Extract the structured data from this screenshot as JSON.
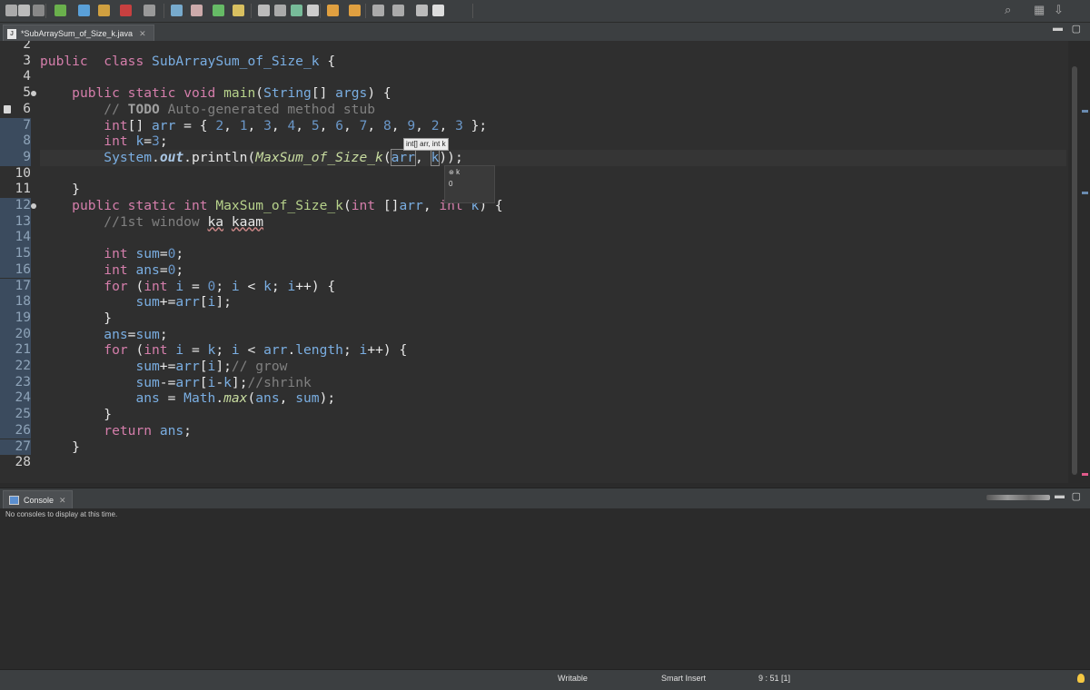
{
  "tab": {
    "title": "*SubArraySum_of_Size_k.java"
  },
  "editor": {
    "lines": [
      {
        "n": "2",
        "segs": []
      },
      {
        "n": "3",
        "segs": [
          [
            "kw",
            "public"
          ],
          [
            "",
            "  "
          ],
          [
            "kw",
            "class"
          ],
          [
            "",
            " "
          ],
          [
            "cls",
            "SubArraySum_of_Size_k"
          ],
          [
            "",
            " {"
          ]
        ]
      },
      {
        "n": "4",
        "segs": []
      },
      {
        "n": "5",
        "fold": true,
        "segs": [
          [
            "",
            "    "
          ],
          [
            "kw",
            "public"
          ],
          [
            "",
            " "
          ],
          [
            "kw",
            "static"
          ],
          [
            "",
            " "
          ],
          [
            "kw",
            "void"
          ],
          [
            "",
            " "
          ],
          [
            "mth",
            "main"
          ],
          [
            "",
            "("
          ],
          [
            "typ",
            "String"
          ],
          [
            "",
            "[] "
          ],
          [
            "typ",
            "args"
          ],
          [
            "",
            ") {"
          ]
        ]
      },
      {
        "n": "6",
        "marker": true,
        "segs": [
          [
            "cm",
            "        // "
          ],
          [
            "tag",
            "TODO"
          ],
          [
            "cm",
            " Auto-generated method stub"
          ]
        ]
      },
      {
        "n": "7",
        "segs": [
          [
            "",
            "        "
          ],
          [
            "kw",
            "int"
          ],
          [
            "",
            "[] "
          ],
          [
            "typ",
            "arr"
          ],
          [
            "",
            " = { "
          ],
          [
            "num",
            "2"
          ],
          [
            "",
            ", "
          ],
          [
            "num",
            "1"
          ],
          [
            "",
            ", "
          ],
          [
            "num",
            "3"
          ],
          [
            "",
            ", "
          ],
          [
            "num",
            "4"
          ],
          [
            "",
            ", "
          ],
          [
            "num",
            "5"
          ],
          [
            "",
            ", "
          ],
          [
            "num",
            "6"
          ],
          [
            "",
            ", "
          ],
          [
            "num",
            "7"
          ],
          [
            "",
            ", "
          ],
          [
            "num",
            "8"
          ],
          [
            "",
            ", "
          ],
          [
            "num",
            "9"
          ],
          [
            "",
            ", "
          ],
          [
            "num",
            "2"
          ],
          [
            "",
            ", "
          ],
          [
            "num",
            "3"
          ],
          [
            "",
            " };"
          ]
        ]
      },
      {
        "n": "8",
        "segs": [
          [
            "",
            "        "
          ],
          [
            "kw",
            "int"
          ],
          [
            "",
            " "
          ],
          [
            "typ",
            "k"
          ],
          [
            "",
            "="
          ],
          [
            "num",
            "3"
          ],
          [
            "",
            ";"
          ]
        ]
      },
      {
        "n": "9",
        "current": true,
        "segs": [
          [
            "",
            "        "
          ],
          [
            "cls",
            "System"
          ],
          [
            "",
            "."
          ],
          [
            "fld",
            "out"
          ],
          [
            "",
            ".println("
          ],
          [
            "itm",
            "MaxSum_of_Size_k"
          ],
          [
            "",
            "("
          ],
          [
            "box",
            "arr"
          ],
          [
            "",
            ", "
          ],
          [
            "box",
            "k"
          ],
          [
            "",
            "));"
          ]
        ]
      },
      {
        "n": "10",
        "segs": []
      },
      {
        "n": "11",
        "segs": [
          [
            "",
            "    }"
          ]
        ]
      },
      {
        "n": "12",
        "fold": true,
        "segs": [
          [
            "",
            "    "
          ],
          [
            "kw",
            "public"
          ],
          [
            "",
            " "
          ],
          [
            "kw",
            "static"
          ],
          [
            "",
            " "
          ],
          [
            "kw",
            "int"
          ],
          [
            "",
            " "
          ],
          [
            "mth",
            "MaxSum_of_Size_k"
          ],
          [
            "",
            "("
          ],
          [
            "kw",
            "int"
          ],
          [
            "",
            " []"
          ],
          [
            "typ",
            "arr"
          ],
          [
            "",
            ", "
          ],
          [
            "kw",
            "int"
          ],
          [
            "",
            " "
          ],
          [
            "typ",
            "k"
          ],
          [
            "",
            ") {"
          ]
        ]
      },
      {
        "n": "13",
        "segs": [
          [
            "cm",
            "        //1st window "
          ],
          [
            "sq",
            "ka"
          ],
          [
            "cm",
            " "
          ],
          [
            "sq",
            "kaam"
          ]
        ]
      },
      {
        "n": "14",
        "segs": []
      },
      {
        "n": "15",
        "segs": [
          [
            "",
            "        "
          ],
          [
            "kw",
            "int"
          ],
          [
            "",
            " "
          ],
          [
            "typ",
            "sum"
          ],
          [
            "",
            "="
          ],
          [
            "num",
            "0"
          ],
          [
            "",
            ";"
          ]
        ]
      },
      {
        "n": "16",
        "segs": [
          [
            "",
            "        "
          ],
          [
            "kw",
            "int"
          ],
          [
            "",
            " "
          ],
          [
            "typ",
            "ans"
          ],
          [
            "",
            "="
          ],
          [
            "num",
            "0"
          ],
          [
            "",
            ";"
          ]
        ]
      },
      {
        "n": "17",
        "segs": [
          [
            "",
            "        "
          ],
          [
            "kw",
            "for"
          ],
          [
            "",
            " ("
          ],
          [
            "kw",
            "int"
          ],
          [
            "",
            " "
          ],
          [
            "typ",
            "i"
          ],
          [
            "",
            " = "
          ],
          [
            "num",
            "0"
          ],
          [
            "",
            "; "
          ],
          [
            "typ",
            "i"
          ],
          [
            "",
            " < "
          ],
          [
            "typ",
            "k"
          ],
          [
            "",
            "; "
          ],
          [
            "typ",
            "i"
          ],
          [
            "",
            "++) {"
          ]
        ]
      },
      {
        "n": "18",
        "segs": [
          [
            "",
            "            "
          ],
          [
            "typ",
            "sum"
          ],
          [
            "",
            "+="
          ],
          [
            "typ",
            "arr"
          ],
          [
            "",
            "["
          ],
          [
            "typ",
            "i"
          ],
          [
            "",
            "];"
          ]
        ]
      },
      {
        "n": "19",
        "segs": [
          [
            "",
            "        }"
          ]
        ]
      },
      {
        "n": "20",
        "segs": [
          [
            "",
            "        "
          ],
          [
            "typ",
            "ans"
          ],
          [
            "",
            "="
          ],
          [
            "typ",
            "sum"
          ],
          [
            "",
            ";"
          ]
        ]
      },
      {
        "n": "21",
        "segs": [
          [
            "",
            "        "
          ],
          [
            "kw",
            "for"
          ],
          [
            "",
            " ("
          ],
          [
            "kw",
            "int"
          ],
          [
            "",
            " "
          ],
          [
            "typ",
            "i"
          ],
          [
            "",
            " = "
          ],
          [
            "typ",
            "k"
          ],
          [
            "",
            "; "
          ],
          [
            "typ",
            "i"
          ],
          [
            "",
            " < "
          ],
          [
            "typ",
            "arr"
          ],
          [
            "",
            "."
          ],
          [
            "typ",
            "length"
          ],
          [
            "",
            "; "
          ],
          [
            "typ",
            "i"
          ],
          [
            "",
            "++) {"
          ]
        ]
      },
      {
        "n": "22",
        "segs": [
          [
            "",
            "            "
          ],
          [
            "typ",
            "sum"
          ],
          [
            "",
            "+="
          ],
          [
            "typ",
            "arr"
          ],
          [
            "",
            "["
          ],
          [
            "typ",
            "i"
          ],
          [
            "",
            "];"
          ],
          [
            "cm",
            "// grow"
          ]
        ]
      },
      {
        "n": "23",
        "segs": [
          [
            "",
            "            "
          ],
          [
            "typ",
            "sum"
          ],
          [
            "",
            "-="
          ],
          [
            "typ",
            "arr"
          ],
          [
            "",
            "["
          ],
          [
            "typ",
            "i"
          ],
          [
            "",
            "-"
          ],
          [
            "typ",
            "k"
          ],
          [
            "",
            "];"
          ],
          [
            "cm",
            "//shrink"
          ]
        ]
      },
      {
        "n": "24",
        "segs": [
          [
            "",
            "            "
          ],
          [
            "typ",
            "ans"
          ],
          [
            "",
            " = "
          ],
          [
            "cls",
            "Math"
          ],
          [
            "",
            "."
          ],
          [
            "itm",
            "max"
          ],
          [
            "",
            "("
          ],
          [
            "typ",
            "ans"
          ],
          [
            "",
            ", "
          ],
          [
            "typ",
            "sum"
          ],
          [
            "",
            ");"
          ]
        ]
      },
      {
        "n": "25",
        "segs": [
          [
            "",
            "        }"
          ]
        ]
      },
      {
        "n": "26",
        "segs": [
          [
            "",
            "        "
          ],
          [
            "kw",
            "return"
          ],
          [
            "",
            " "
          ],
          [
            "typ",
            "ans"
          ],
          [
            "",
            ";"
          ]
        ]
      },
      {
        "n": "27",
        "segs": [
          [
            "",
            "    }"
          ]
        ]
      },
      {
        "n": "28",
        "segs": []
      }
    ],
    "hint_text": "int[] arr, int k",
    "popup_items": [
      "k",
      "0"
    ]
  },
  "console": {
    "tab_label": "Console",
    "message": "No consoles to display at this time."
  },
  "status": {
    "writable": "Writable",
    "insert_mode": "Smart Insert",
    "position": "9 : 51 [1]"
  },
  "colors": {
    "keyword": "#d57eab",
    "type": "#7aaee2",
    "method": "#b7d28b",
    "number": "#6a97c8",
    "comment": "#808080"
  }
}
